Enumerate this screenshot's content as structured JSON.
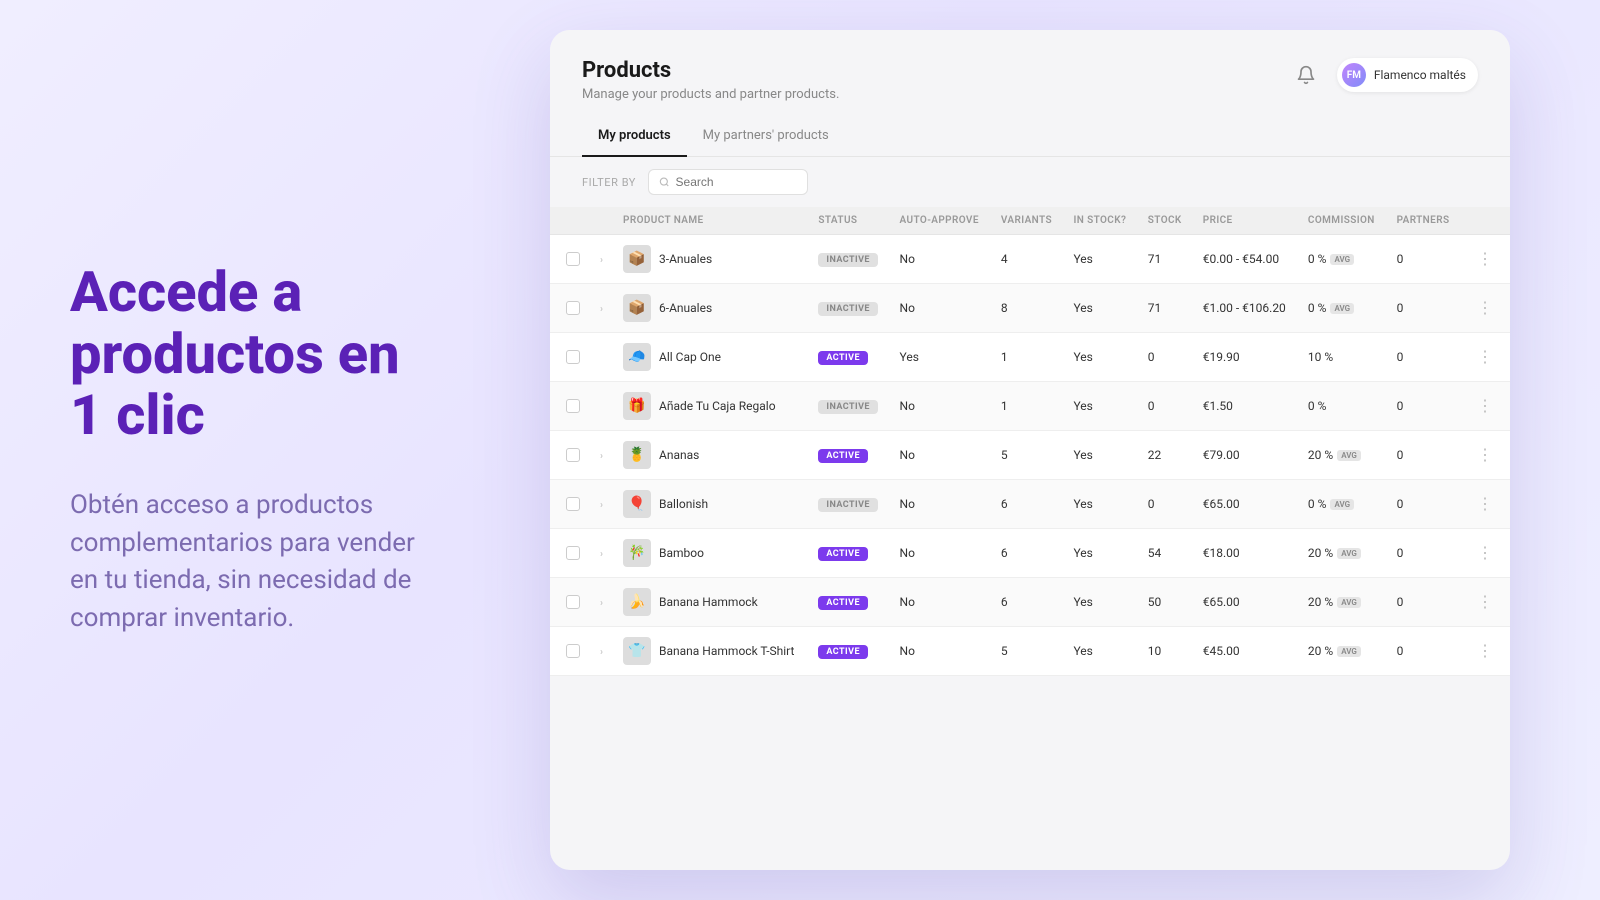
{
  "left": {
    "headline": "Accede a productos en 1 clic",
    "description": "Obtén acceso a productos complementarios para vender en tu tienda, sin necesidad de comprar inventario."
  },
  "header": {
    "title": "Products",
    "subtitle": "Manage your products and partner products.",
    "bell_icon": "🔔",
    "user_name": "Flamenco maltés",
    "user_initials": "FM"
  },
  "tabs": [
    {
      "label": "My products",
      "active": true
    },
    {
      "label": "My partners' products",
      "active": false
    }
  ],
  "filter": {
    "label": "FILTER BY",
    "search_placeholder": "Search"
  },
  "table": {
    "columns": [
      "",
      "",
      "PRODUCT NAME",
      "STATUS",
      "AUTO-APPROVE",
      "VARIANTS",
      "IN STOCK?",
      "STOCK",
      "PRICE",
      "COMMISSION",
      "PARTNERS",
      ""
    ],
    "rows": [
      {
        "name": "3-Anuales",
        "status": "INACTIVE",
        "auto_approve": "No",
        "variants": 4,
        "in_stock": "Yes",
        "stock": 71,
        "price": "€0.00 - €54.00",
        "commission": "0 %",
        "commission_badge": "AVG",
        "partners": 0,
        "has_expand": true,
        "thumb": "📦"
      },
      {
        "name": "6-Anuales",
        "status": "INACTIVE",
        "auto_approve": "No",
        "variants": 8,
        "in_stock": "Yes",
        "stock": 71,
        "price": "€1.00 - €106.20",
        "commission": "0 %",
        "commission_badge": "AVG",
        "partners": 0,
        "has_expand": true,
        "thumb": "📦"
      },
      {
        "name": "All Cap One",
        "status": "ACTIVE",
        "auto_approve": "Yes",
        "variants": 1,
        "in_stock": "Yes",
        "stock": 0,
        "price": "€19.90",
        "commission": "10 %",
        "commission_badge": "",
        "partners": 0,
        "has_expand": false,
        "thumb": "🧢"
      },
      {
        "name": "Añade Tu Caja Regalo",
        "status": "INACTIVE",
        "auto_approve": "No",
        "variants": 1,
        "in_stock": "Yes",
        "stock": 0,
        "price": "€1.50",
        "commission": "0 %",
        "commission_badge": "",
        "partners": 0,
        "has_expand": false,
        "thumb": "🎁"
      },
      {
        "name": "Ananas",
        "status": "ACTIVE",
        "auto_approve": "No",
        "variants": 5,
        "in_stock": "Yes",
        "stock": 22,
        "price": "€79.00",
        "commission": "20 %",
        "commission_badge": "AVG",
        "partners": 0,
        "has_expand": true,
        "thumb": "🍍"
      },
      {
        "name": "Ballonish",
        "status": "INACTIVE",
        "auto_approve": "No",
        "variants": 6,
        "in_stock": "Yes",
        "stock": 0,
        "price": "€65.00",
        "commission": "0 %",
        "commission_badge": "AVG",
        "partners": 0,
        "has_expand": true,
        "thumb": "🎈"
      },
      {
        "name": "Bamboo",
        "status": "ACTIVE",
        "auto_approve": "No",
        "variants": 6,
        "in_stock": "Yes",
        "stock": 54,
        "price": "€18.00",
        "commission": "20 %",
        "commission_badge": "AVG",
        "partners": 0,
        "has_expand": true,
        "thumb": "🎋"
      },
      {
        "name": "Banana Hammock",
        "status": "ACTIVE",
        "auto_approve": "No",
        "variants": 6,
        "in_stock": "Yes",
        "stock": 50,
        "price": "€65.00",
        "commission": "20 %",
        "commission_badge": "AVG",
        "partners": 0,
        "has_expand": true,
        "thumb": "🍌"
      },
      {
        "name": "Banana Hammock T-Shirt",
        "status": "ACTIVE",
        "auto_approve": "No",
        "variants": 5,
        "in_stock": "Yes",
        "stock": 10,
        "price": "€45.00",
        "commission": "20 %",
        "commission_badge": "AVG",
        "partners": 0,
        "has_expand": true,
        "thumb": "👕"
      }
    ]
  },
  "colors": {
    "accent_purple": "#5b21b6",
    "active_badge": "#7c3aed",
    "inactive_badge": "#e0e0e0"
  }
}
